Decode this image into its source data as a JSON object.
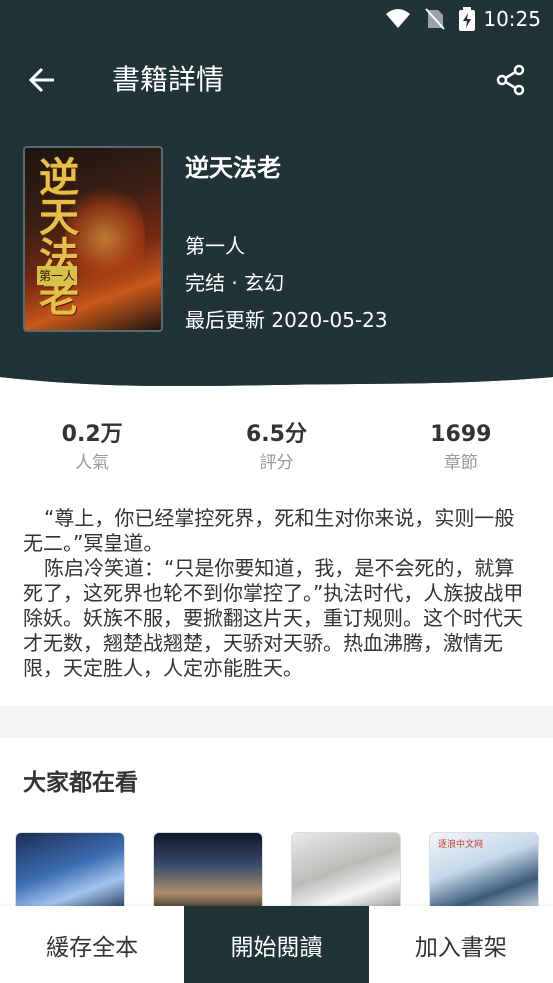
{
  "status_bar": {
    "time": "10:25"
  },
  "header": {
    "title": "書籍詳情"
  },
  "book": {
    "title": "逆天法老",
    "author": "第一人",
    "status_line": "完结 · 玄幻",
    "updated": "最后更新 2020-05-23",
    "cover_text": "逆天法老",
    "cover_sub": "第一人"
  },
  "stats": [
    {
      "value": "0.2万",
      "label": "人氣"
    },
    {
      "value": "6.5分",
      "label": "評分"
    },
    {
      "value": "1699",
      "label": "章節"
    }
  ],
  "description": [
    "“尊上，你已经掌控死界，死和生对你来说，实则一般无二。”冥皇道。",
    "陈启冷笑道：“只是你要知道，我，是不会死的，就算死了，这死界也轮不到你掌控了。”执法时代，人族披战甲除妖。妖族不服，要掀翻这片天，重订规则。这个时代天才无数，翘楚战翘楚，天骄对天骄。热血沸腾，激情无限，天定胜人，人定亦能胜天。"
  ],
  "recommend": {
    "title": "大家都在看",
    "items": [
      {
        "tag": ""
      },
      {
        "tag": ""
      },
      {
        "tag": ""
      },
      {
        "tag": "逐浪中文网"
      }
    ]
  },
  "actions": {
    "cache": "緩存全本",
    "read": "開始閱讀",
    "shelf": "加入書架"
  },
  "colors": {
    "header_bg": "#223338",
    "primary": "#223338"
  }
}
